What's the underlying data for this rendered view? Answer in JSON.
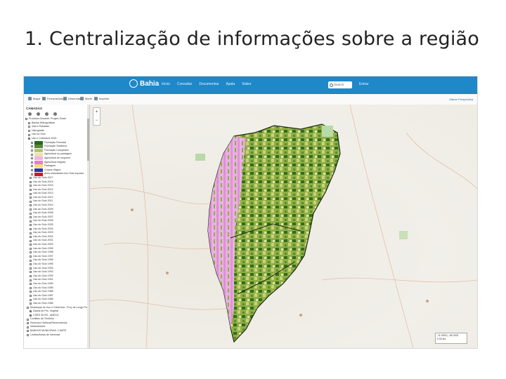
{
  "slide": {
    "title": "1. Centralização de informações sobre a região"
  },
  "app": {
    "brand": "Bahia",
    "nav": [
      "Início",
      "Consultar",
      "Documentos",
      "Ajuda",
      "Sobre"
    ],
    "search_placeholder": "Search",
    "login": "Entrar"
  },
  "toolbar": {
    "items": [
      "Mapa",
      "Ferramentas",
      "Desenhar",
      "Medir",
      "Imprimir"
    ],
    "right_link": "Alterar Perspectiva"
  },
  "sidebar": {
    "heading": "CAMADAS",
    "tree": [
      {
        "label": "Produtos Geoamb. Projeto Oeste",
        "kind": "folder"
      },
      {
        "label": "Bacias Hidrográficas",
        "kind": "folder"
      },
      {
        "label": "Vias e Estradas",
        "kind": "folder"
      },
      {
        "label": "Hidrografia",
        "kind": "folder"
      },
      {
        "label": "Uso do Solo",
        "kind": "folder"
      },
      {
        "label": "Uso e Cobertura 2015",
        "kind": "checked"
      }
    ],
    "legend": [
      {
        "label": "Formação Florestal",
        "color": "#1f6b1f"
      },
      {
        "label": "Formação Savânica",
        "color": "#5a8a2a"
      },
      {
        "label": "Formação Campestre",
        "color": "#b9c46a"
      },
      {
        "label": "Agricultura ou pastagem",
        "color": "#e8e2b0"
      },
      {
        "label": "Agricultura de sequeiro",
        "color": "#f2b4e6"
      },
      {
        "label": "Agricultura irrigada",
        "color": "#e47be0"
      },
      {
        "label": "Pastagem",
        "color": "#ffd87a"
      },
      {
        "label": "Corpos d'água",
        "color": "#1c3aa8"
      },
      {
        "label": "Área urbanizada e/ou Solo exposto",
        "color": "#d2142f"
      }
    ],
    "years": [
      "Uso do Solo 2017",
      "Uso do Solo 2016",
      "Uso do Solo 2015",
      "Uso do Solo 2014",
      "Uso do Solo 2013",
      "Uso do Solo 2012",
      "Uso do Solo 2011",
      "Uso do Solo 2010",
      "Uso do Solo 2009",
      "Uso do Solo 2008",
      "Uso do Solo 2007",
      "Uso do Solo 2006",
      "Uso do Solo 2005",
      "Uso do Solo 2004",
      "Uso do Solo 2003",
      "Uso do Solo 2002",
      "Uso do Solo 2001",
      "Uso do Solo 2000",
      "Uso do Solo 1999",
      "Uso do Solo 1998",
      "Uso do Solo 1997",
      "Uso do Solo 1996",
      "Uso do Solo 1995",
      "Uso do Solo 1994",
      "Uso do Solo 1993",
      "Uso do Solo 1992",
      "Uso do Solo 1991",
      "Uso do Solo 1990",
      "Uso do Solo 1989",
      "Uso do Solo 1988",
      "Uso do Solo 1987",
      "Uso do Solo 1986",
      "Uso do Solo 1985"
    ],
    "bottom": [
      {
        "label": "Mudanças de Uso e Cobertura - Proj. de Longo Prazo",
        "kind": "folder"
      },
      {
        "label": "Dados de Pto. Vegetal",
        "kind": "checked"
      },
      {
        "label": "CSRS 35 RS - ANEXO",
        "kind": "checked"
      },
      {
        "label": "Conflitos de Território",
        "kind": "folder"
      },
      {
        "label": "Recursos Hídricos/Reservatórios",
        "kind": "folder"
      },
      {
        "label": "Infraestrutura",
        "kind": "folder"
      },
      {
        "label": "BANHOS MUNICIPAIS / LIMITE",
        "kind": "folder"
      },
      {
        "label": "Limites/Áreas de Interesse",
        "kind": "folder"
      }
    ]
  },
  "map": {
    "scale_line1": "-11.0000 | -45.2200",
    "scale_line2": "0    50 km"
  }
}
